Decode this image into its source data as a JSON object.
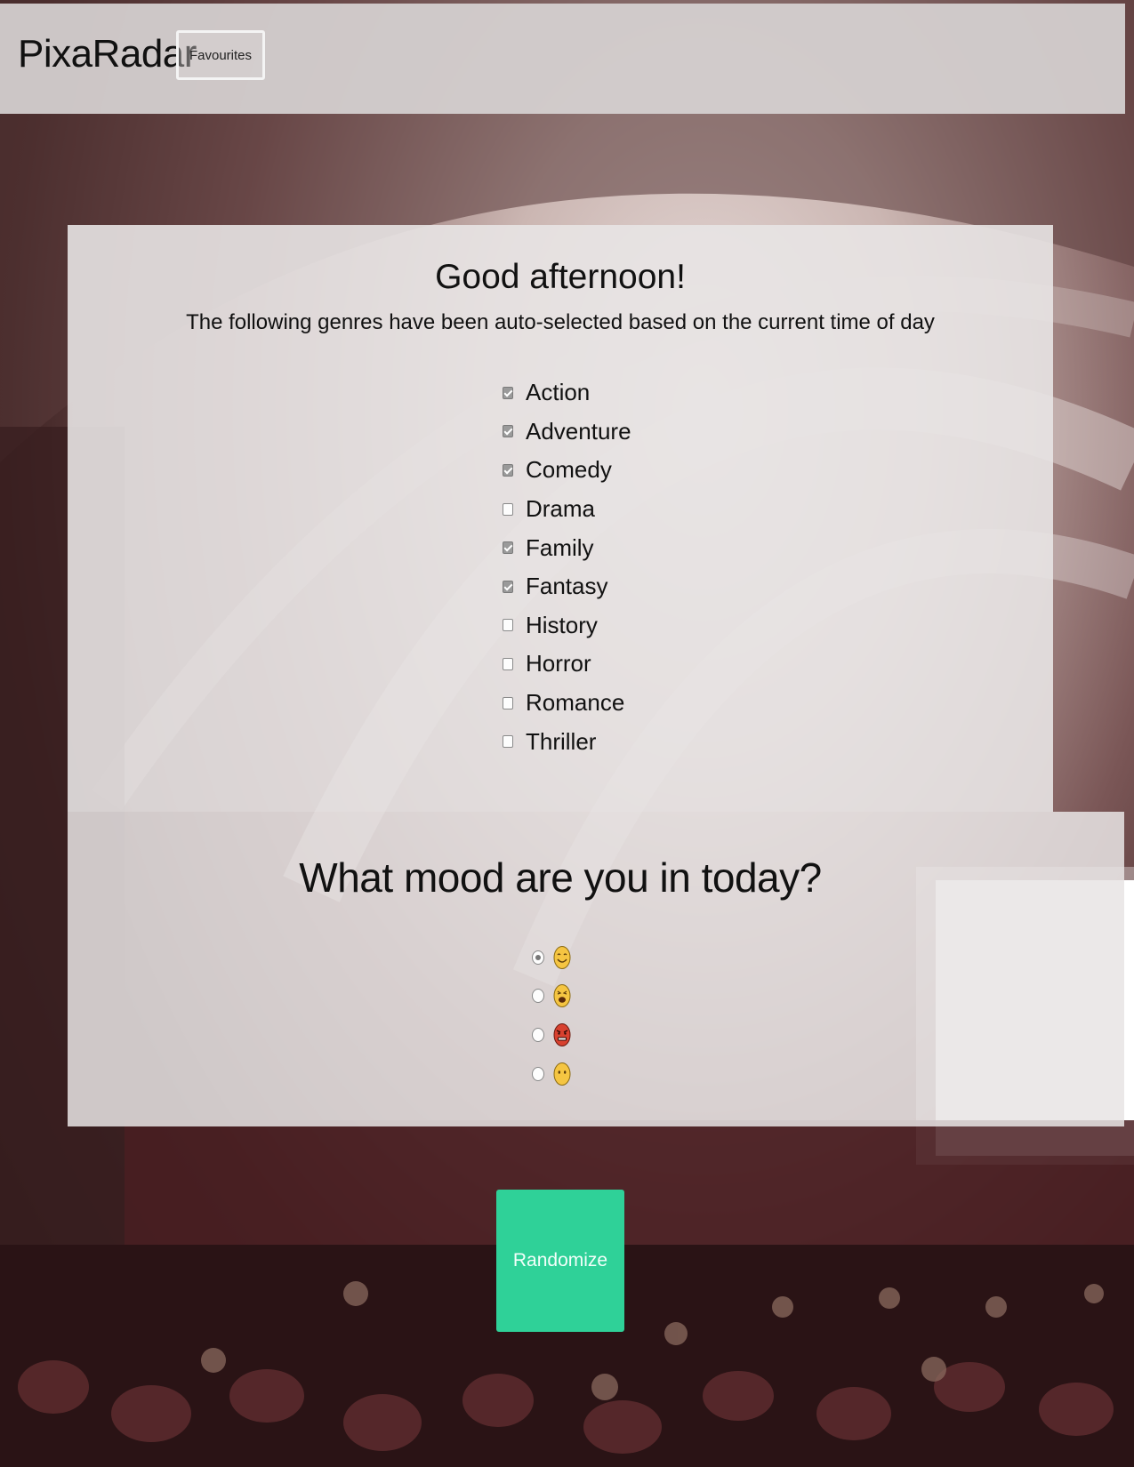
{
  "header": {
    "brand": "PixaRadar",
    "favourites_label": "Favourites"
  },
  "main": {
    "greeting": "Good afternoon!",
    "subtitle": "The following genres have been auto-selected based on the current time of day",
    "genres": [
      {
        "label": "Action",
        "checked": true
      },
      {
        "label": "Adventure",
        "checked": true
      },
      {
        "label": "Comedy",
        "checked": true
      },
      {
        "label": "Drama",
        "checked": false
      },
      {
        "label": "Family",
        "checked": true
      },
      {
        "label": "Fantasy",
        "checked": true
      },
      {
        "label": "History",
        "checked": false
      },
      {
        "label": "Horror",
        "checked": false
      },
      {
        "label": "Romance",
        "checked": false
      },
      {
        "label": "Thriller",
        "checked": false
      }
    ],
    "mood_question": "What mood are you in today?",
    "moods": [
      {
        "icon": "smiling-face-icon",
        "checked": true
      },
      {
        "icon": "weary-face-icon",
        "checked": false
      },
      {
        "icon": "angry-face-icon",
        "checked": false
      },
      {
        "icon": "neutral-face-icon",
        "checked": false
      }
    ]
  },
  "actions": {
    "randomize_label": "Randomize"
  },
  "colors": {
    "accent": "#2fd198",
    "header_bg": "#d6d2d2",
    "panel_bg": "#e8e4e4"
  }
}
